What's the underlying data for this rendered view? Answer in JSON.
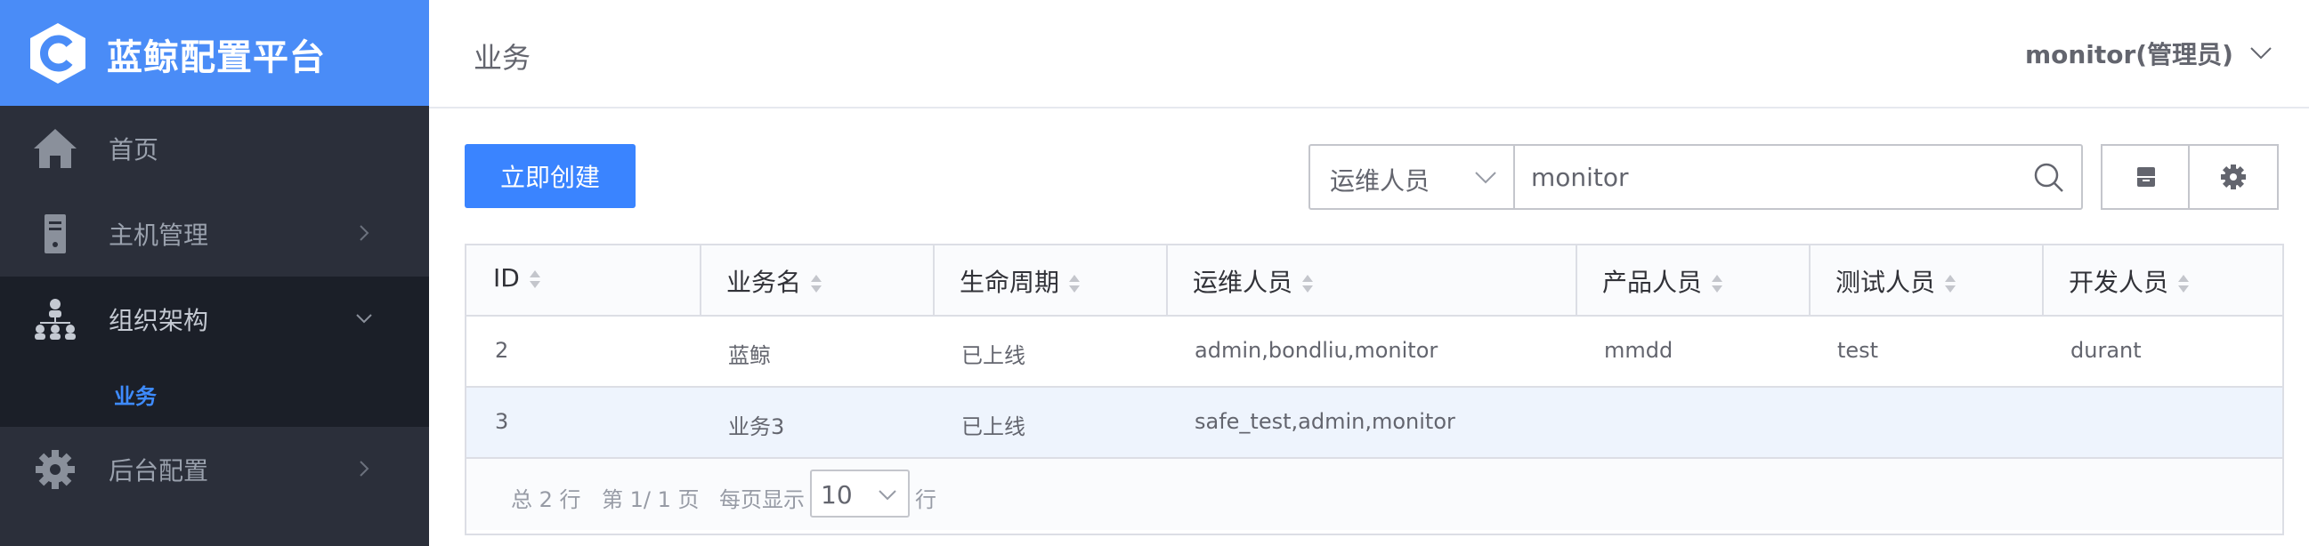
{
  "brand": {
    "title": "蓝鲸配置平台",
    "color": "#4a8cf7"
  },
  "sidebar": {
    "items": [
      {
        "label": "首页",
        "icon": "home-icon"
      },
      {
        "label": "主机管理",
        "icon": "server-icon"
      },
      {
        "label": "组织架构",
        "icon": "org-structure-icon"
      },
      {
        "label": "后台配置",
        "icon": "gear-icon"
      }
    ],
    "subitems": [
      {
        "label": "业务",
        "active": true
      }
    ]
  },
  "header": {
    "title": "业务",
    "user": "monitor(管理员)"
  },
  "toolbar": {
    "create_label": "立即创建",
    "filter_field": "运维人员",
    "search_value": "monitor"
  },
  "table": {
    "columns": [
      "ID",
      "业务名",
      "生命周期",
      "运维人员",
      "产品人员",
      "测试人员",
      "开发人员"
    ],
    "rows": [
      [
        "2",
        "蓝鲸",
        "已上线",
        "admin,bondliu,monitor",
        "mmdd",
        "test",
        "durant"
      ],
      [
        "3",
        "业务3",
        "已上线",
        "safe_test,admin,monitor",
        "",
        "",
        ""
      ]
    ]
  },
  "pagination": {
    "total": "总 2 行",
    "page": "第 1/ 1 页",
    "per_page_label": "每页显示",
    "per_page_value": "10",
    "row_suffix": "行"
  },
  "colors": {
    "accent": "#3a84ff",
    "sidebar_bg": "#2b2f3a",
    "sidebar_active_bg": "#1b1f28"
  }
}
